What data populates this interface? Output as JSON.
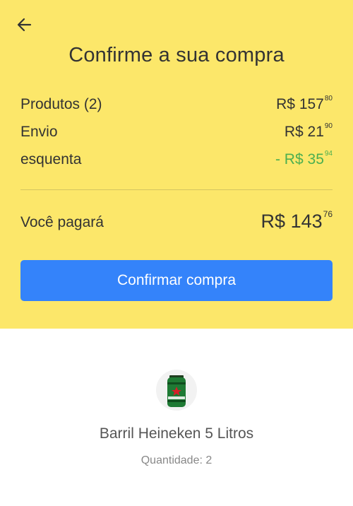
{
  "header": {
    "title": "Confirme a sua compra",
    "back_icon": "arrow-left-icon"
  },
  "summary": {
    "products": {
      "label": "Produtos (2)",
      "currency": "R$",
      "whole": "157",
      "cents": "80"
    },
    "shipping": {
      "label": "Envio",
      "currency": "R$",
      "whole": "21",
      "cents": "90"
    },
    "discount": {
      "label": "esquenta",
      "currency": "- R$",
      "whole": "35",
      "cents": "94"
    },
    "total": {
      "label": "Você pagará",
      "currency": "R$",
      "whole": "143",
      "cents": "76"
    }
  },
  "cta": {
    "label": "Confirmar compra"
  },
  "product": {
    "name": "Barril Heineken 5 Litros",
    "quantity": "Quantidade: 2",
    "image_icon": "beer-keg-icon"
  },
  "colors": {
    "header_bg": "#fce76a",
    "primary_button": "#3483fa",
    "discount_text": "#4caf50"
  }
}
